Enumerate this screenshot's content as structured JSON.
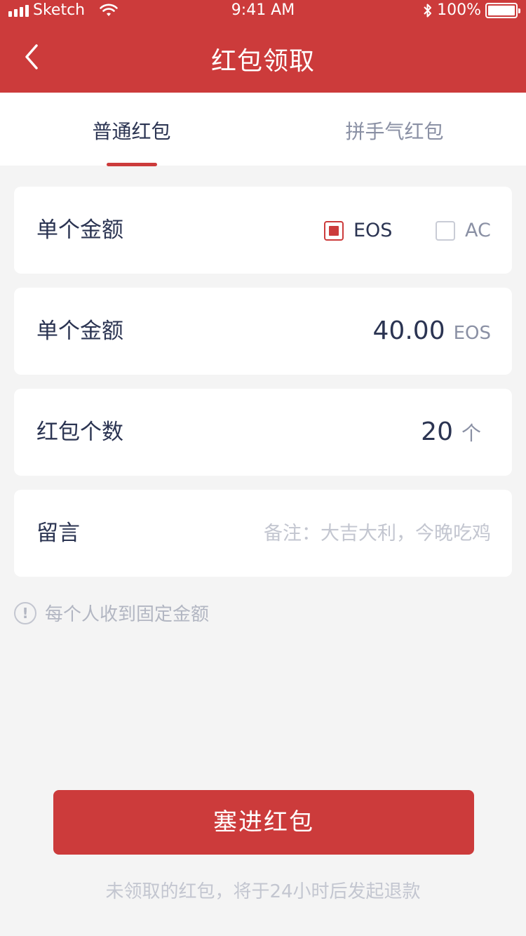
{
  "status_bar": {
    "carrier": "Sketch",
    "time": "9:41 AM",
    "battery": "100%"
  },
  "header": {
    "title": "红包领取",
    "back_icon": "chevron-left-icon"
  },
  "tabs": [
    {
      "label": "普通红包",
      "active": true
    },
    {
      "label": "拼手气红包",
      "active": false
    }
  ],
  "currency_row": {
    "label": "单个金额",
    "options": [
      {
        "label": "EOS",
        "checked": true
      },
      {
        "label": "AC",
        "checked": false
      }
    ]
  },
  "amount_row": {
    "label": "单个金额",
    "value": "40.00",
    "unit": "EOS"
  },
  "count_row": {
    "label": "红包个数",
    "value": "20",
    "unit": "个"
  },
  "memo_row": {
    "label": "留言",
    "placeholder": "备注：大吉大利，今晚吃鸡",
    "value": ""
  },
  "tip": {
    "icon": "exclamation-circle-icon",
    "text": "每个人收到固定金额"
  },
  "submit": {
    "label": "塞进红包"
  },
  "footnote": "未领取的红包，将于24小时后发起退款",
  "colors": {
    "brand": "#cc3b3b",
    "text_dark": "#2b3452",
    "text_muted": "#8a90a4",
    "background": "#f4f4f4"
  }
}
